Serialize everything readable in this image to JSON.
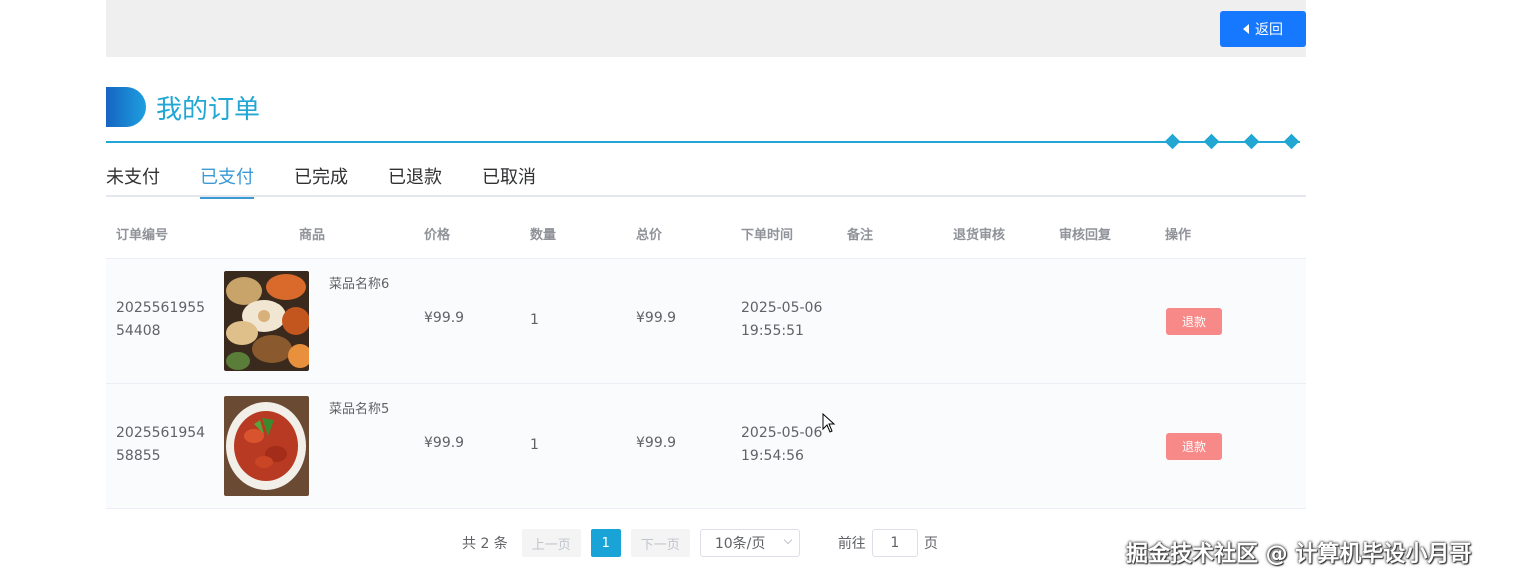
{
  "header": {
    "back_label": "返回"
  },
  "page": {
    "title": "我的订单"
  },
  "tabs": [
    {
      "label": "未支付",
      "active": false
    },
    {
      "label": "已支付",
      "active": true
    },
    {
      "label": "已完成",
      "active": false
    },
    {
      "label": "已退款",
      "active": false
    },
    {
      "label": "已取消",
      "active": false
    }
  ],
  "table": {
    "columns": [
      "订单编号",
      "商品",
      "价格",
      "数量",
      "总价",
      "下单时间",
      "备注",
      "退货审核",
      "审核回复",
      "操作"
    ],
    "rows": [
      {
        "order_id": "202556195554408",
        "dish_name": "菜品名称6",
        "price": "¥99.9",
        "quantity": "1",
        "total": "¥99.9",
        "time_date": "2025-05-06",
        "time_clock": "19:55:51",
        "note": "",
        "refund_review": "",
        "review_reply": "",
        "action": "退款"
      },
      {
        "order_id": "202556195458855",
        "dish_name": "菜品名称5",
        "price": "¥99.9",
        "quantity": "1",
        "total": "¥99.9",
        "time_date": "2025-05-06",
        "time_clock": "19:54:56",
        "note": "",
        "refund_review": "",
        "review_reply": "",
        "action": "退款"
      }
    ]
  },
  "pagination": {
    "total_text": "共 2 条",
    "prev_label": "上一页",
    "current_page": "1",
    "next_label": "下一页",
    "page_size": "10条/页",
    "goto_label": "前往",
    "goto_value": "1",
    "page_unit": "页"
  },
  "watermark": "掘金技术社区 @ 计算机毕设小月哥",
  "colors": {
    "accent": "#22a7d4",
    "primary": "#1677ff",
    "danger": "#f78989",
    "active_tab": "#3b9ad6"
  }
}
